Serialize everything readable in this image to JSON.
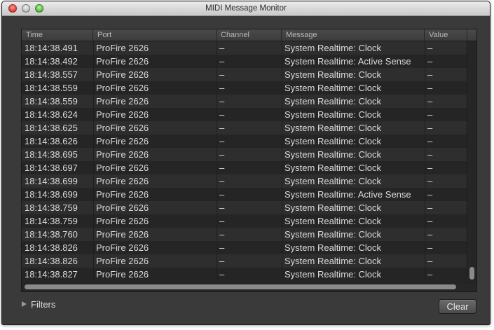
{
  "window": {
    "title": "MIDI Message Monitor"
  },
  "table": {
    "columns": [
      "Time",
      "Port",
      "Channel",
      "Message",
      "Value"
    ],
    "rows": [
      [
        "18:14:38.491",
        "ProFire 2626",
        "–",
        "System Realtime: Clock",
        "–"
      ],
      [
        "18:14:38.492",
        "ProFire 2626",
        "–",
        "System Realtime: Active Sense",
        "–"
      ],
      [
        "18:14:38.557",
        "ProFire 2626",
        "–",
        "System Realtime: Clock",
        "–"
      ],
      [
        "18:14:38.559",
        "ProFire 2626",
        "–",
        "System Realtime: Clock",
        "–"
      ],
      [
        "18:14:38.559",
        "ProFire 2626",
        "–",
        "System Realtime: Clock",
        "–"
      ],
      [
        "18:14:38.624",
        "ProFire 2626",
        "–",
        "System Realtime: Clock",
        "–"
      ],
      [
        "18:14:38.625",
        "ProFire 2626",
        "–",
        "System Realtime: Clock",
        "–"
      ],
      [
        "18:14:38.626",
        "ProFire 2626",
        "–",
        "System Realtime: Clock",
        "–"
      ],
      [
        "18:14:38.695",
        "ProFire 2626",
        "–",
        "System Realtime: Clock",
        "–"
      ],
      [
        "18:14:38.697",
        "ProFire 2626",
        "–",
        "System Realtime: Clock",
        "–"
      ],
      [
        "18:14:38.699",
        "ProFire 2626",
        "–",
        "System Realtime: Clock",
        "–"
      ],
      [
        "18:14:38.699",
        "ProFire 2626",
        "–",
        "System Realtime: Active Sense",
        "–"
      ],
      [
        "18:14:38.759",
        "ProFire 2626",
        "–",
        "System Realtime: Clock",
        "–"
      ],
      [
        "18:14:38.759",
        "ProFire 2626",
        "–",
        "System Realtime: Clock",
        "–"
      ],
      [
        "18:14:38.760",
        "ProFire 2626",
        "–",
        "System Realtime: Clock",
        "–"
      ],
      [
        "18:14:38.826",
        "ProFire 2626",
        "–",
        "System Realtime: Clock",
        "–"
      ],
      [
        "18:14:38.826",
        "ProFire 2626",
        "–",
        "System Realtime: Clock",
        "–"
      ],
      [
        "18:14:38.827",
        "ProFire 2626",
        "–",
        "System Realtime: Clock",
        "–"
      ]
    ]
  },
  "footer": {
    "filters_label": "Filters",
    "clear_label": "Clear"
  },
  "icons": {
    "filters_disclosure": "disclosure-triangle-right-icon"
  },
  "colors": {
    "window_bg": "#3a3a3a",
    "row_odd": "#2e2e2e",
    "row_even": "#252525",
    "text": "#dcdcdc",
    "header_text": "#b8b8b8"
  }
}
